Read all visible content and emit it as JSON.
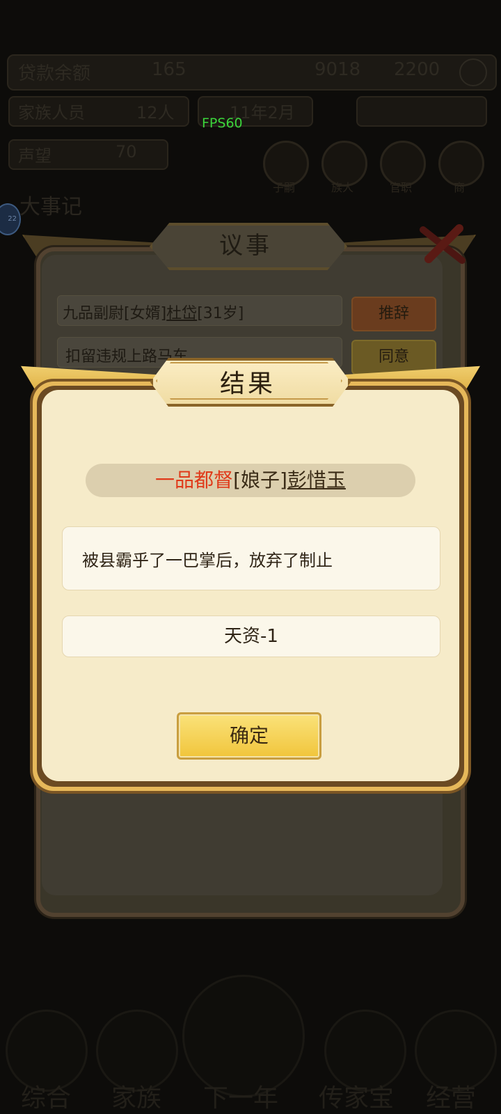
{
  "background": {
    "top_stats": {
      "left_text": "贷款余额",
      "mid_value": "165",
      "right_value": "9018",
      "coin_value": "2200"
    },
    "second_row": {
      "label": "家族人员",
      "count": "12人",
      "date": "11年2月"
    },
    "third_row": {
      "label": "声望",
      "value": "70"
    },
    "circle_buttons": [
      "子嗣",
      "族人",
      "官职",
      "商"
    ],
    "fps": "FPS60",
    "events_title": "大事记",
    "badge": "22"
  },
  "back_panel": {
    "title": "议事",
    "rows": [
      {
        "text_prefix": "九品副尉[女婿]",
        "name": "杜岱",
        "text_suffix": "[31岁]",
        "button": "推辞"
      },
      {
        "text_prefix": "扣留违规上路马车",
        "name": "",
        "text_suffix": "",
        "button": "同意"
      }
    ]
  },
  "bottom_nav": [
    "综合",
    "家族",
    "下一年",
    "传家宝",
    "经营"
  ],
  "dialog": {
    "title": "结果",
    "rank": "一品都督",
    "relation": "[娘子]",
    "person_name": "彭惜玉",
    "description": "被县霸乎了一巴掌后，放弃了制止",
    "effect": "天资-1",
    "confirm_label": "确定"
  },
  "colors": {
    "rank_red": "#e03a1a",
    "dialog_body": "#f6ebc9",
    "gold_button": "#f1c53b",
    "frame_gold": "#e6b85a"
  }
}
